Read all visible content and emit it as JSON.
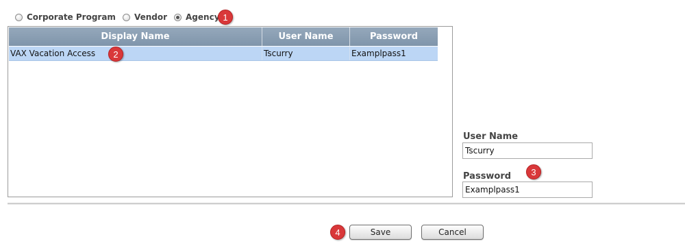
{
  "radio_options": [
    {
      "label": "Corporate Program",
      "checked": false
    },
    {
      "label": "Vendor",
      "checked": false
    },
    {
      "label": "Agency",
      "checked": true
    }
  ],
  "badges": [
    "1",
    "2",
    "3",
    "4"
  ],
  "grid": {
    "columns": [
      "Display Name",
      "User Name",
      "Password"
    ],
    "rows": [
      [
        "VAX Vacation Access",
        "Tscurry",
        "Examplpass1"
      ]
    ]
  },
  "form": {
    "username_label": "User Name",
    "username_value": "Tscurry",
    "password_label": "Password",
    "password_value": "Examplpass1"
  },
  "buttons": {
    "save": "Save",
    "cancel": "Cancel"
  },
  "colors": {
    "header_bg": "#869bb0",
    "selected_row": "#bcd6f5",
    "badge": "#d9383a"
  }
}
